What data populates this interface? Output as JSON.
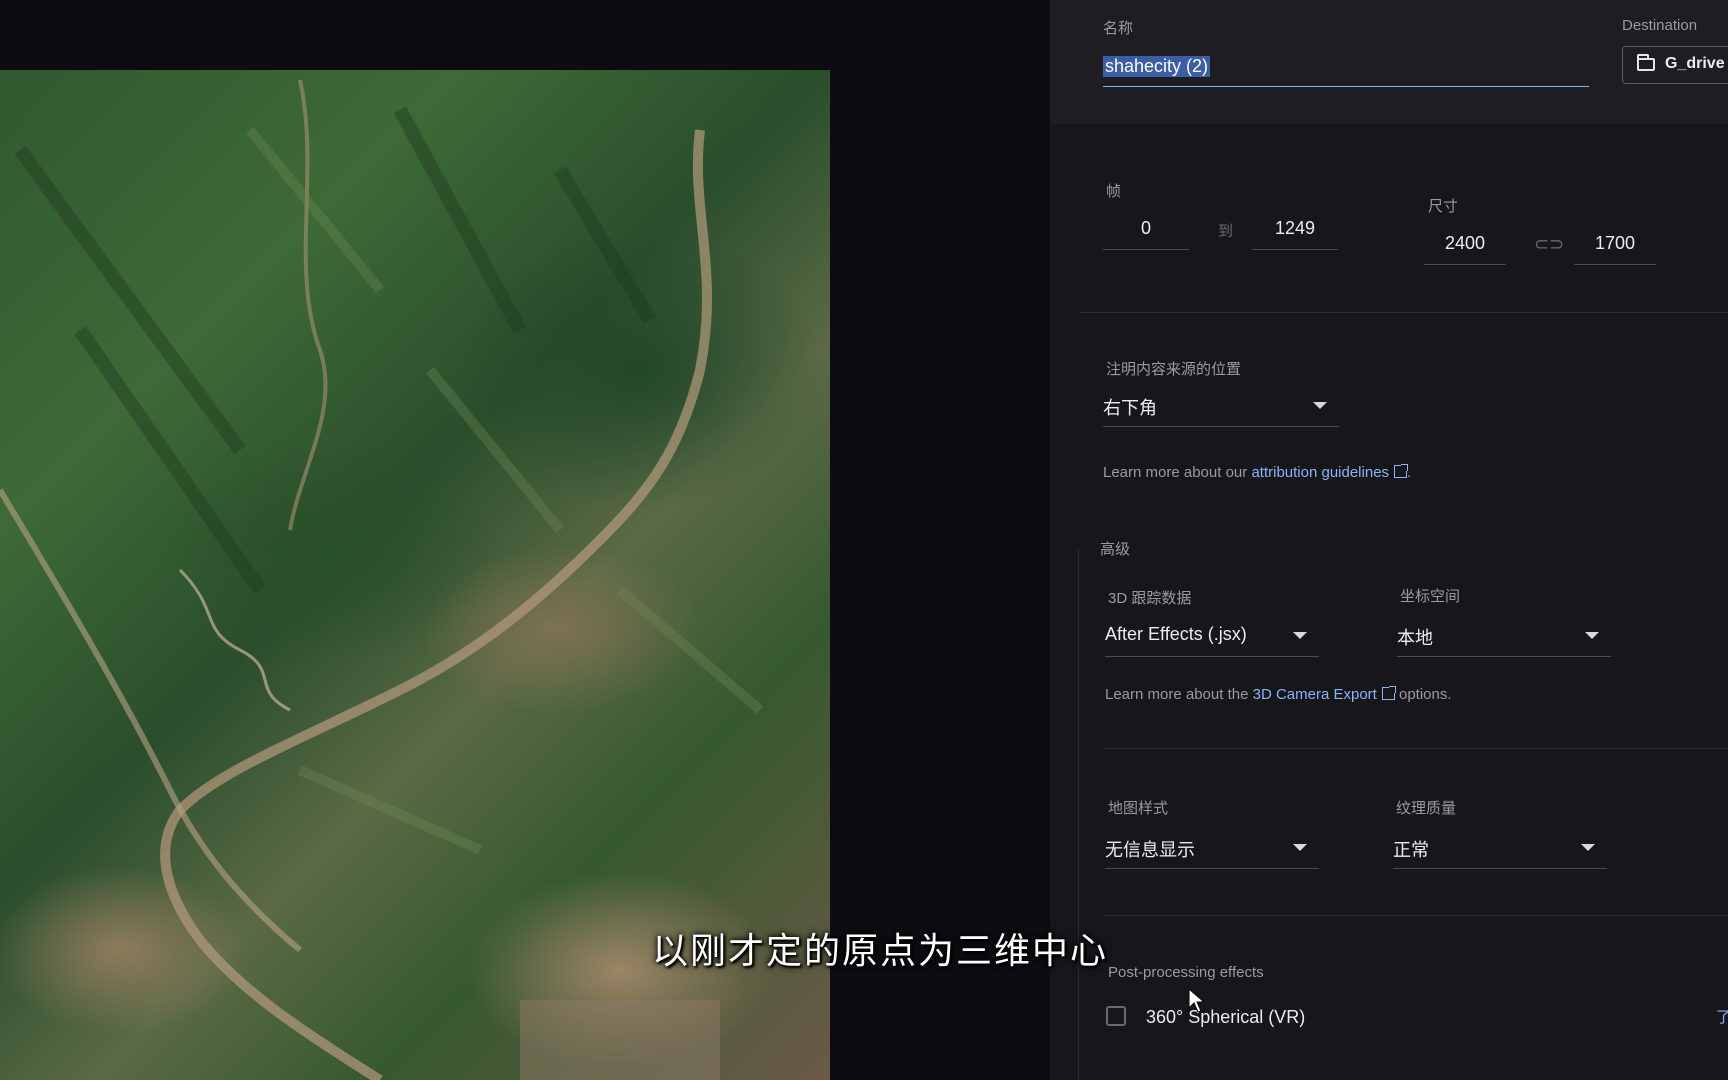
{
  "preview": {
    "image": "satellite terrain map preview of mountains and river valley"
  },
  "panel": {
    "name_label": "名称",
    "name_value": "shahecity (2)",
    "destination_label": "Destination",
    "destination_value": "G_drive",
    "frames_label": "帧",
    "frame_start": "0",
    "frame_to": "到",
    "frame_end": "1249",
    "size_label": "尺寸",
    "width": "2400",
    "height": "1700",
    "attribution_label": "注明内容来源的位置",
    "attribution_value": "右下角",
    "attribution_help_prefix": "Learn more about our ",
    "attribution_help_link": "attribution guidelines",
    "attribution_help_suffix": ".",
    "advanced_label": "高级",
    "tracking_label": "3D 跟踪数据",
    "tracking_value": "After Effects (.jsx)",
    "coord_label": "坐标空间",
    "coord_value": "本地",
    "camera_help_prefix": "Learn more about the ",
    "camera_help_link": "3D Camera Export",
    "camera_help_suffix": " options.",
    "map_style_label": "地图样式",
    "map_style_value": "无信息显示",
    "texture_label": "纹理质量",
    "texture_value": "正常",
    "post_label": "Post-processing effects",
    "vr_label": "360° Spherical (VR)",
    "edge_text": "了"
  },
  "subtitle": "以刚才定的原点为三维中心",
  "icons": {
    "folder": "folder-icon",
    "link": "link-icon",
    "external": "external-link-icon",
    "caret": "chevron-down-icon",
    "cursor": "mouse-cursor-icon"
  }
}
